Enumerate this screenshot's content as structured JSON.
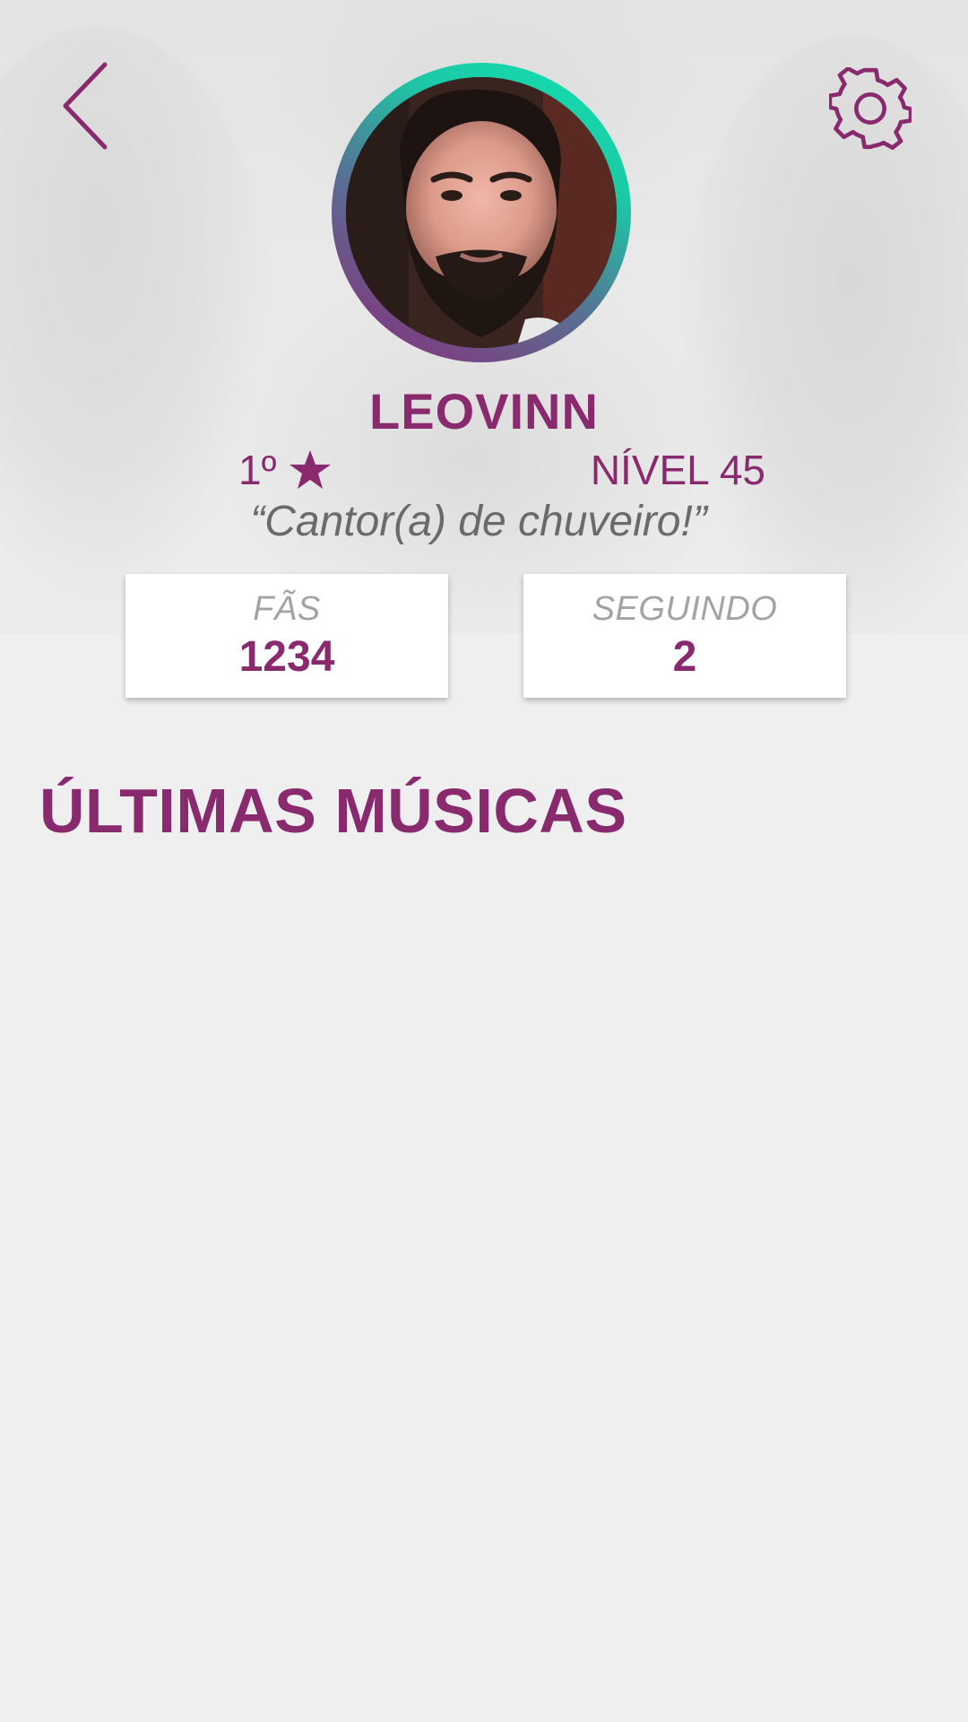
{
  "profile": {
    "username": "LEOVINN",
    "rank": "1º",
    "level": "NÍVEL 45",
    "quote": "“Cantor(a) de chuveiro!”"
  },
  "stats": {
    "fans_label": "FÃS",
    "fans_value": "1234",
    "following_label": "SEGUINDO",
    "following_value": "2"
  },
  "sections": {
    "latest_songs_title": "ÚLTIMAS MÚSICAS"
  },
  "icons": {
    "back": "back-chevron-icon",
    "settings": "gear-icon",
    "rank": "star-icon"
  },
  "colors": {
    "brand": "#8a2a6e",
    "ring_start": "#10e3b0",
    "ring_end": "#8a2a78",
    "background": "#efefef"
  }
}
